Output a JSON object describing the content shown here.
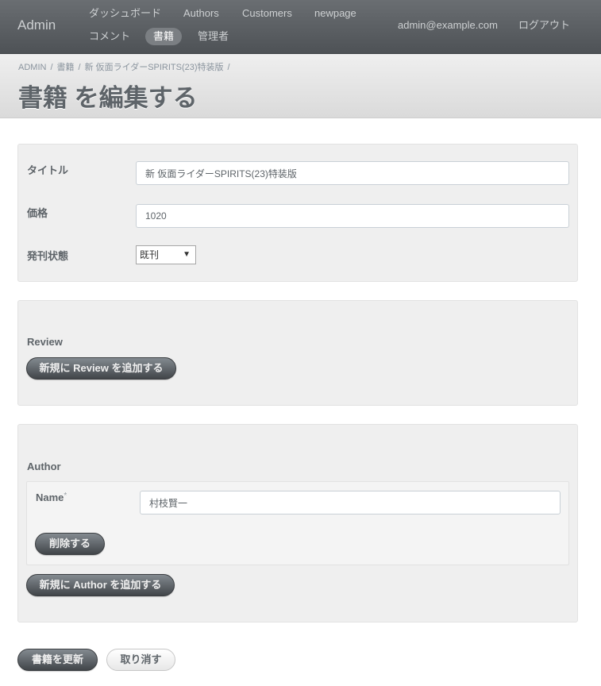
{
  "header": {
    "brand": "Admin",
    "nav": [
      {
        "label": "ダッシュボード"
      },
      {
        "label": "Authors"
      },
      {
        "label": "Customers"
      },
      {
        "label": "newpage"
      },
      {
        "label": "コメント"
      },
      {
        "label": "書籍",
        "active": true
      },
      {
        "label": "管理者"
      }
    ],
    "user_email": "admin@example.com",
    "logout": "ログアウト"
  },
  "breadcrumb": [
    "ADMIN",
    "書籍",
    "新 仮面ライダーSPIRITS(23)特装版"
  ],
  "breadcrumb_sep": "/",
  "page_title": "書籍 を編集する",
  "form": {
    "title_label": "タイトル",
    "title_value": "新 仮面ライダーSPIRITS(23)特装版",
    "price_label": "価格",
    "price_value": "1020",
    "status_label": "発刊状態",
    "status_value": "既刊",
    "status_arrow": "▼"
  },
  "review": {
    "heading": "Review",
    "add_button": "新規に Review を追加する"
  },
  "author": {
    "heading": "Author",
    "name_label": "Name",
    "required_mark": "*",
    "name_value": "村枝賢一",
    "delete_button": "削除する",
    "add_button": "新規に Author を追加する"
  },
  "actions": {
    "submit": "書籍を更新",
    "cancel": "取り消す"
  }
}
